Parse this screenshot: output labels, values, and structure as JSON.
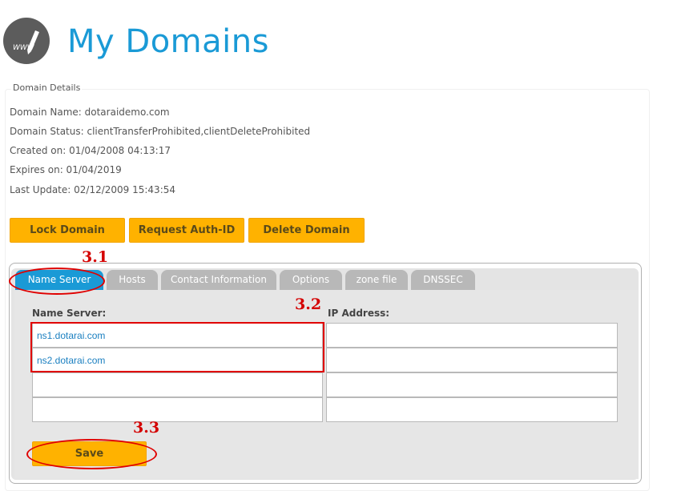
{
  "header": {
    "title": "My Domains",
    "logo_text": "WWW"
  },
  "details": {
    "legend": "Domain Details",
    "rows": [
      "Domain Name: dotaraidemo.com",
      "Domain Status: clientTransferProhibited,clientDeleteProhibited",
      "Created on: 01/04/2008 04:13:17",
      "Expires on: 01/04/2019",
      "Last Update: 02/12/2009 15:43:54"
    ]
  },
  "actions": {
    "lock": "Lock Domain",
    "auth": "Request Auth-ID",
    "delete": "Delete Domain"
  },
  "tabs": [
    "Name Server",
    "Hosts",
    "Contact Information",
    "Options",
    "zone file",
    "DNSSEC"
  ],
  "name_servers": {
    "ns_label": "Name Server:",
    "ip_label": "IP Address:",
    "rows": [
      {
        "ns": "ns1.dotarai.com",
        "ip": ""
      },
      {
        "ns": "ns2.dotarai.com",
        "ip": ""
      },
      {
        "ns": "",
        "ip": ""
      },
      {
        "ns": "",
        "ip": ""
      }
    ],
    "save": "Save"
  },
  "annotations": [
    "3.1",
    "3.2",
    "3.3"
  ],
  "colors": {
    "accent": "#1a9ad6",
    "button": "#ffb200",
    "annotation": "#e00000"
  }
}
